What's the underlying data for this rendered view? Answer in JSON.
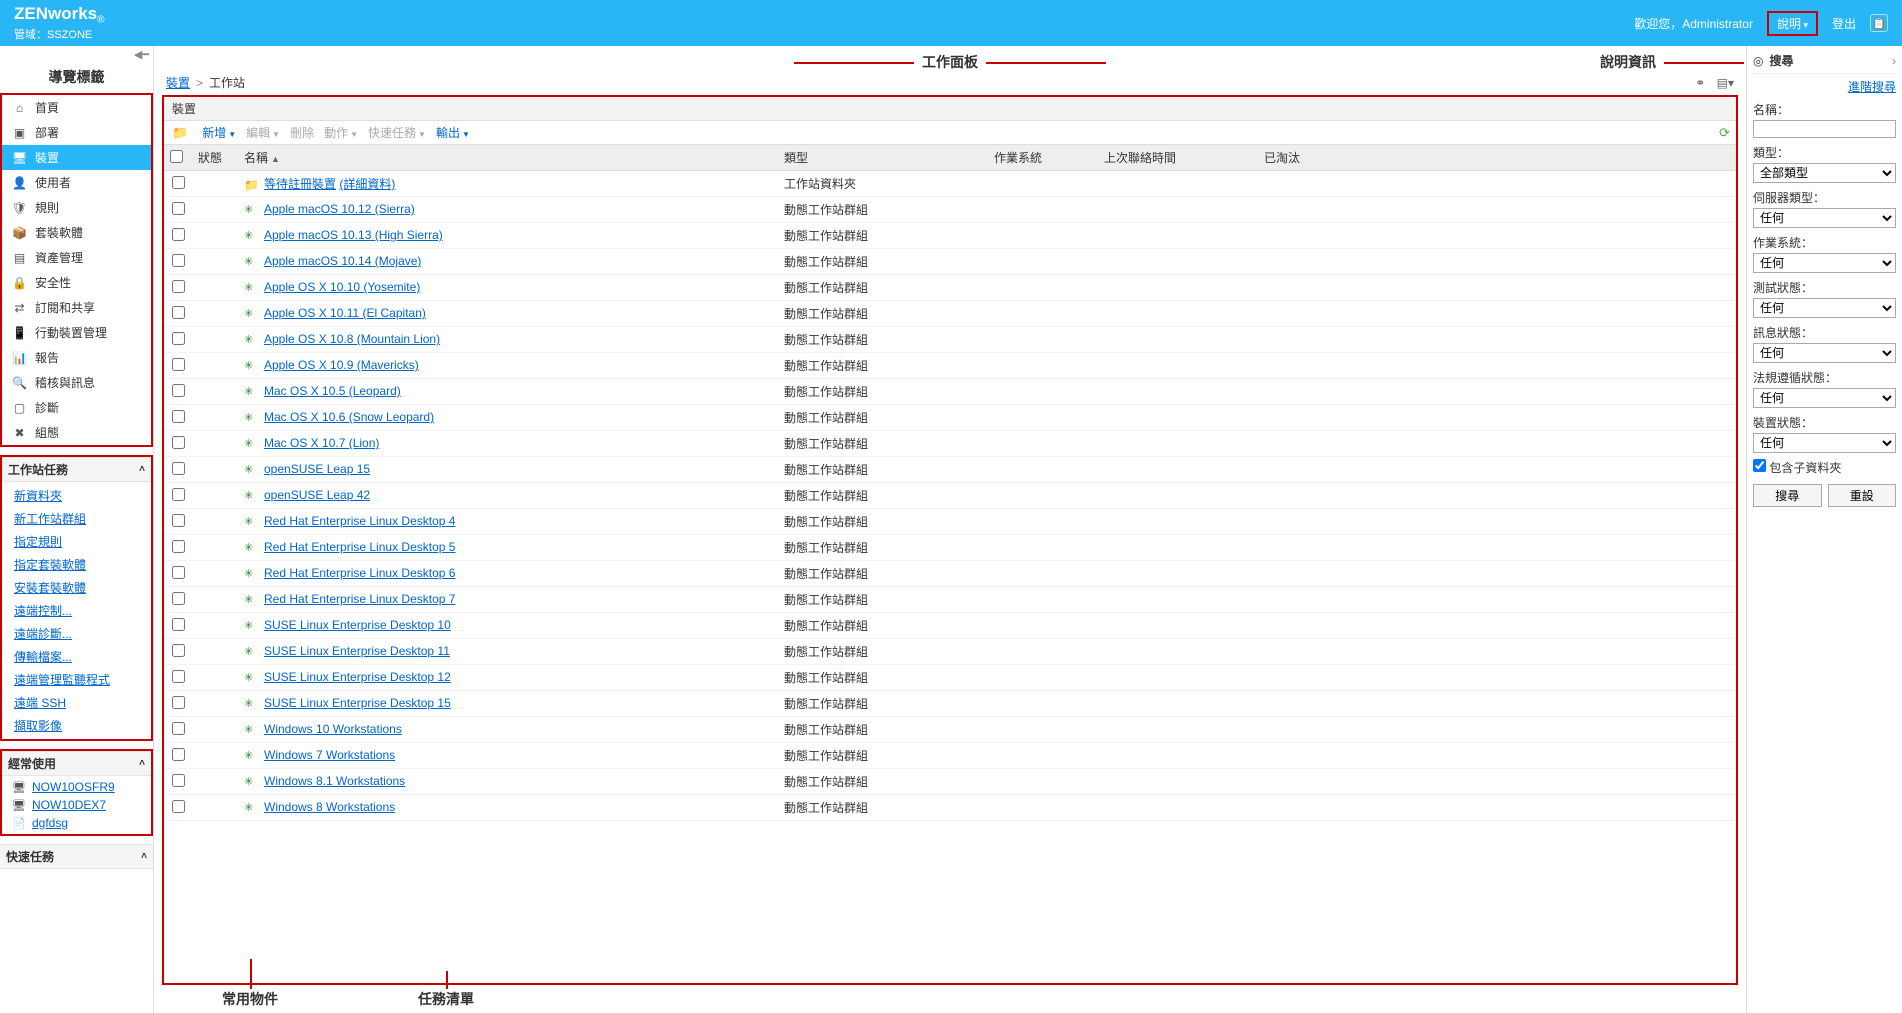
{
  "header": {
    "brand": "ZENworks",
    "brand_sub": "®",
    "zone_prefix": "管域：",
    "zone": "SSZONE",
    "welcome_prefix": "歡迎您，",
    "user": "Administrator",
    "help": "說明",
    "logout": "登出"
  },
  "annotations": {
    "nav_tabs": "導覽標籤",
    "work_panel": "工作面板",
    "help_info": "說明資訊",
    "task_list": "任務清單",
    "freq_objects": "常用物件"
  },
  "nav": [
    {
      "icon": "⌂",
      "label": "首頁"
    },
    {
      "icon": "▣",
      "label": "部署"
    },
    {
      "icon": "🖥",
      "label": "裝置",
      "active": true
    },
    {
      "icon": "👤",
      "label": "使用者"
    },
    {
      "icon": "🛡",
      "label": "規則"
    },
    {
      "icon": "📦",
      "label": "套裝軟體"
    },
    {
      "icon": "▤",
      "label": "資產管理"
    },
    {
      "icon": "🔒",
      "label": "安全性"
    },
    {
      "icon": "⇄",
      "label": "訂閱和共享"
    },
    {
      "icon": "📱",
      "label": "行動裝置管理"
    },
    {
      "icon": "📊",
      "label": "報告"
    },
    {
      "icon": "🔍",
      "label": "稽核與訊息"
    },
    {
      "icon": "▢",
      "label": "診斷"
    },
    {
      "icon": "✖",
      "label": "組態"
    }
  ],
  "task_panel_title": "工作站任務",
  "tasks": [
    "新資料夾",
    "新工作站群組",
    "指定規則",
    "指定套裝軟體",
    "安裝套裝軟體",
    "遠端控制...",
    "遠端診斷...",
    "傳輸檔案...",
    "遠端管理監聽程式",
    "遠端 SSH",
    "擷取影像"
  ],
  "freq_title": "經常使用",
  "freq": [
    {
      "icon": "🖥",
      "label": "NOW10OSFR9"
    },
    {
      "icon": "🖥",
      "label": "NOW10DEX7"
    },
    {
      "icon": "📄",
      "label": "dgfdsg"
    }
  ],
  "quick_title": "快速任務",
  "breadcrumb": {
    "root": "裝置",
    "sep": ">",
    "current": "工作站"
  },
  "grid": {
    "title": "裝置",
    "toolbar": {
      "new": "新增",
      "edit": "編輯",
      "delete": "刪除",
      "action": "動作",
      "quick": "快速任務",
      "export": "輸出"
    },
    "columns": {
      "status": "狀態",
      "name": "名稱",
      "type": "類型",
      "os": "作業系統",
      "last": "上次聯絡時間",
      "retired": "已淘汰"
    },
    "rows": [
      {
        "kind": "folder",
        "name": "等待註冊裝置",
        "detail": "(詳細資料)",
        "type": "工作站資料夾"
      },
      {
        "kind": "group",
        "name": "Apple macOS 10.12 (Sierra)",
        "type": "動態工作站群組"
      },
      {
        "kind": "group",
        "name": "Apple macOS 10.13 (High Sierra)",
        "type": "動態工作站群組"
      },
      {
        "kind": "group",
        "name": "Apple macOS 10.14 (Mojave)",
        "type": "動態工作站群組"
      },
      {
        "kind": "group",
        "name": "Apple OS X 10.10 (Yosemite)",
        "type": "動態工作站群組"
      },
      {
        "kind": "group",
        "name": "Apple OS X 10.11 (El Capitan)",
        "type": "動態工作站群組"
      },
      {
        "kind": "group",
        "name": "Apple OS X 10.8 (Mountain Lion)",
        "type": "動態工作站群組"
      },
      {
        "kind": "group",
        "name": "Apple OS X 10.9 (Mavericks)",
        "type": "動態工作站群組"
      },
      {
        "kind": "group",
        "name": "Mac OS X 10.5 (Leopard)",
        "type": "動態工作站群組"
      },
      {
        "kind": "group",
        "name": "Mac OS X 10.6 (Snow Leopard)",
        "type": "動態工作站群組"
      },
      {
        "kind": "group",
        "name": "Mac OS X 10.7 (Lion)",
        "type": "動態工作站群組"
      },
      {
        "kind": "group",
        "name": "openSUSE Leap 15",
        "type": "動態工作站群組"
      },
      {
        "kind": "group",
        "name": "openSUSE Leap 42",
        "type": "動態工作站群組"
      },
      {
        "kind": "group",
        "name": "Red Hat Enterprise Linux Desktop 4",
        "type": "動態工作站群組"
      },
      {
        "kind": "group",
        "name": "Red Hat Enterprise Linux Desktop 5",
        "type": "動態工作站群組"
      },
      {
        "kind": "group",
        "name": "Red Hat Enterprise Linux Desktop 6",
        "type": "動態工作站群組"
      },
      {
        "kind": "group",
        "name": "Red Hat Enterprise Linux Desktop 7",
        "type": "動態工作站群組"
      },
      {
        "kind": "group",
        "name": "SUSE Linux Enterprise Desktop 10",
        "type": "動態工作站群組"
      },
      {
        "kind": "group",
        "name": "SUSE Linux Enterprise Desktop 11",
        "type": "動態工作站群組"
      },
      {
        "kind": "group",
        "name": "SUSE Linux Enterprise Desktop 12",
        "type": "動態工作站群組"
      },
      {
        "kind": "group",
        "name": "SUSE Linux Enterprise Desktop 15",
        "type": "動態工作站群組"
      },
      {
        "kind": "group",
        "name": "Windows 10 Workstations",
        "type": "動態工作站群組"
      },
      {
        "kind": "group",
        "name": "Windows 7 Workstations",
        "type": "動態工作站群組"
      },
      {
        "kind": "group",
        "name": "Windows 8.1 Workstations",
        "type": "動態工作站群組"
      },
      {
        "kind": "group",
        "name": "Windows 8 Workstations",
        "type": "動態工作站群組"
      }
    ]
  },
  "search": {
    "title": "搜尋",
    "advanced": "進階搜尋",
    "fields": {
      "name": "名稱：",
      "type": "類型：",
      "server_type": "伺服器類型：",
      "os": "作業系統：",
      "test_status": "測試狀態：",
      "msg_status": "訊息狀態：",
      "compliance": "法規遵循狀態：",
      "dev_status": "裝置狀態："
    },
    "options": {
      "all_types": "全部類型",
      "any": "任何"
    },
    "include_sub": "包含子資料夾",
    "btn_search": "搜尋",
    "btn_reset": "重設"
  }
}
